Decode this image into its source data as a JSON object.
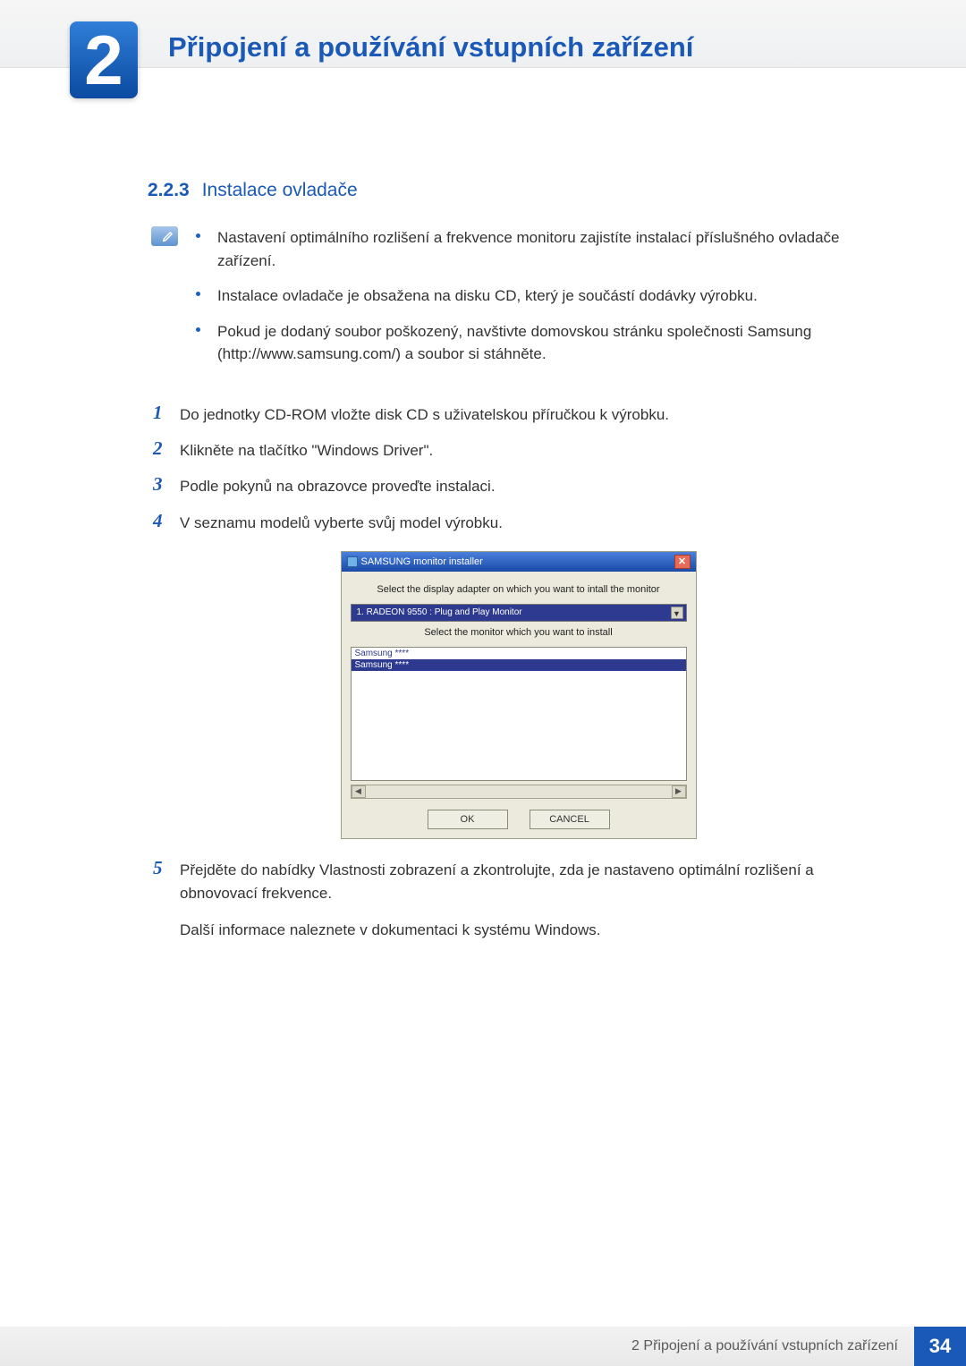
{
  "chapter": {
    "number": "2",
    "title": "Připojení a používání vstupních zařízení"
  },
  "section": {
    "number": "2.2.3",
    "title": "Instalace ovladače"
  },
  "notes": [
    "Nastavení optimálního rozlišení a frekvence monitoru zajistíte instalací příslušného ovladače zařízení.",
    "Instalace ovladače je obsažena na disku CD, který je součástí dodávky výrobku.",
    "Pokud je dodaný soubor poškozený, navštivte domovskou stránku společnosti Samsung (http://www.samsung.com/) a soubor si stáhněte."
  ],
  "steps": [
    {
      "n": "1",
      "text": "Do jednotky CD-ROM vložte disk CD s uživatelskou příručkou k výrobku."
    },
    {
      "n": "2",
      "text": "Klikněte na tlačítko \"Windows Driver\"."
    },
    {
      "n": "3",
      "text": "Podle pokynů na obrazovce proveďte instalaci."
    },
    {
      "n": "4",
      "text": "V seznamu modelů vyberte svůj model výrobku."
    },
    {
      "n": "5",
      "text": "Přejděte do nabídky Vlastnosti zobrazení a zkontrolujte, zda je nastaveno optimální rozlišení a obnovovací frekvence.",
      "extra": "Další informace naleznete v dokumentaci k systému Windows."
    }
  ],
  "installer": {
    "title": "SAMSUNG monitor installer",
    "label_adapter": "Select the display adapter on which you want to intall the monitor",
    "adapter_value": "1. RADEON 9550 : Plug and Play Monitor",
    "label_monitor": "Select the monitor which you want to install",
    "list": [
      "Samsung ****",
      "Samsung ****"
    ],
    "btn_ok": "OK",
    "btn_cancel": "CANCEL"
  },
  "footer": {
    "text": "2 Připojení a používání vstupních zařízení",
    "page": "34"
  }
}
